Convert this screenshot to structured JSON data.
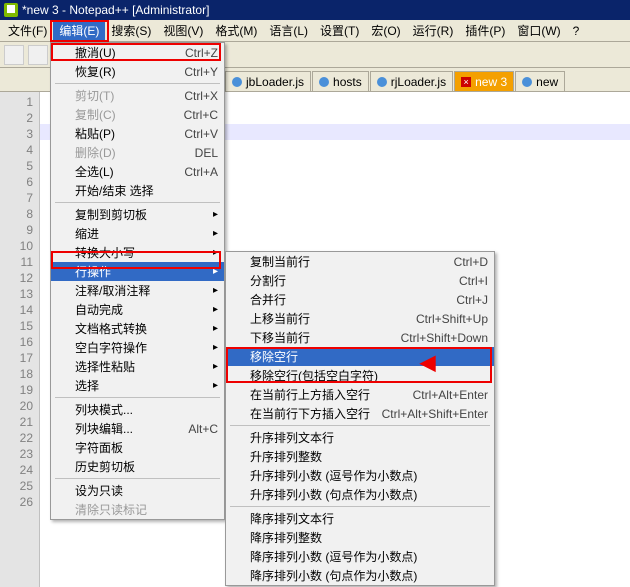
{
  "title": "*new 3 - Notepad++ [Administrator]",
  "menubar": [
    {
      "label": "文件(F)"
    },
    {
      "label": "编辑(E)"
    },
    {
      "label": "搜索(S)"
    },
    {
      "label": "视图(V)"
    },
    {
      "label": "格式(M)"
    },
    {
      "label": "语言(L)"
    },
    {
      "label": "设置(T)"
    },
    {
      "label": "宏(O)"
    },
    {
      "label": "运行(R)"
    },
    {
      "label": "插件(P)"
    },
    {
      "label": "窗口(W)"
    },
    {
      "label": "?"
    }
  ],
  "tabs": [
    {
      "label": "jbLoader.js"
    },
    {
      "label": "hosts"
    },
    {
      "label": "rjLoader.js"
    },
    {
      "label": "new 3",
      "active": true
    },
    {
      "label": "new"
    }
  ],
  "line_count": 26,
  "dropdown1": [
    {
      "label": "撤消(U)",
      "shortcut": "Ctrl+Z",
      "box": true
    },
    {
      "label": "恢复(R)",
      "shortcut": "Ctrl+Y"
    },
    {
      "sep": true
    },
    {
      "label": "剪切(T)",
      "shortcut": "Ctrl+X",
      "disabled": true
    },
    {
      "label": "复制(C)",
      "shortcut": "Ctrl+C",
      "disabled": true
    },
    {
      "label": "粘贴(P)",
      "shortcut": "Ctrl+V"
    },
    {
      "label": "删除(D)",
      "shortcut": "DEL",
      "disabled": true
    },
    {
      "label": "全选(L)",
      "shortcut": "Ctrl+A"
    },
    {
      "label": "开始/结束 选择"
    },
    {
      "sep": true
    },
    {
      "label": "复制到剪切板",
      "sub": true
    },
    {
      "label": "缩进",
      "sub": true
    },
    {
      "label": "转换大小写",
      "sub": true
    },
    {
      "label": "行操作",
      "sub": true,
      "highlight": true,
      "box": true
    },
    {
      "label": "注释/取消注释",
      "sub": true
    },
    {
      "label": "自动完成",
      "sub": true
    },
    {
      "label": "文档格式转换",
      "sub": true
    },
    {
      "label": "空白字符操作",
      "sub": true
    },
    {
      "label": "选择性粘贴",
      "sub": true
    },
    {
      "label": "选择",
      "sub": true
    },
    {
      "sep": true
    },
    {
      "label": "列块模式..."
    },
    {
      "label": "列块编辑...",
      "shortcut": "Alt+C"
    },
    {
      "label": "字符面板"
    },
    {
      "label": "历史剪切板"
    },
    {
      "sep": true
    },
    {
      "label": "设为只读"
    },
    {
      "label": "清除只读标记",
      "disabled": true
    }
  ],
  "dropdown2": [
    {
      "label": "复制当前行",
      "shortcut": "Ctrl+D"
    },
    {
      "label": "分割行",
      "shortcut": "Ctrl+I"
    },
    {
      "label": "合并行",
      "shortcut": "Ctrl+J"
    },
    {
      "label": "上移当前行",
      "shortcut": "Ctrl+Shift+Up"
    },
    {
      "label": "下移当前行",
      "shortcut": "Ctrl+Shift+Down"
    },
    {
      "label": "移除空行",
      "highlight": true,
      "box": true
    },
    {
      "label": "移除空行(包括空白字符)",
      "box": true
    },
    {
      "label": "在当前行上方插入空行",
      "shortcut": "Ctrl+Alt+Enter"
    },
    {
      "label": "在当前行下方插入空行",
      "shortcut": "Ctrl+Alt+Shift+Enter"
    },
    {
      "sep": true
    },
    {
      "label": "升序排列文本行"
    },
    {
      "label": "升序排列整数"
    },
    {
      "label": "升序排列小数 (逗号作为小数点)"
    },
    {
      "label": "升序排列小数 (句点作为小数点)"
    },
    {
      "sep": true
    },
    {
      "label": "降序排列文本行"
    },
    {
      "label": "降序排列整数"
    },
    {
      "label": "降序排列小数 (逗号作为小数点)"
    },
    {
      "label": "降序排列小数 (句点作为小数点)"
    }
  ]
}
